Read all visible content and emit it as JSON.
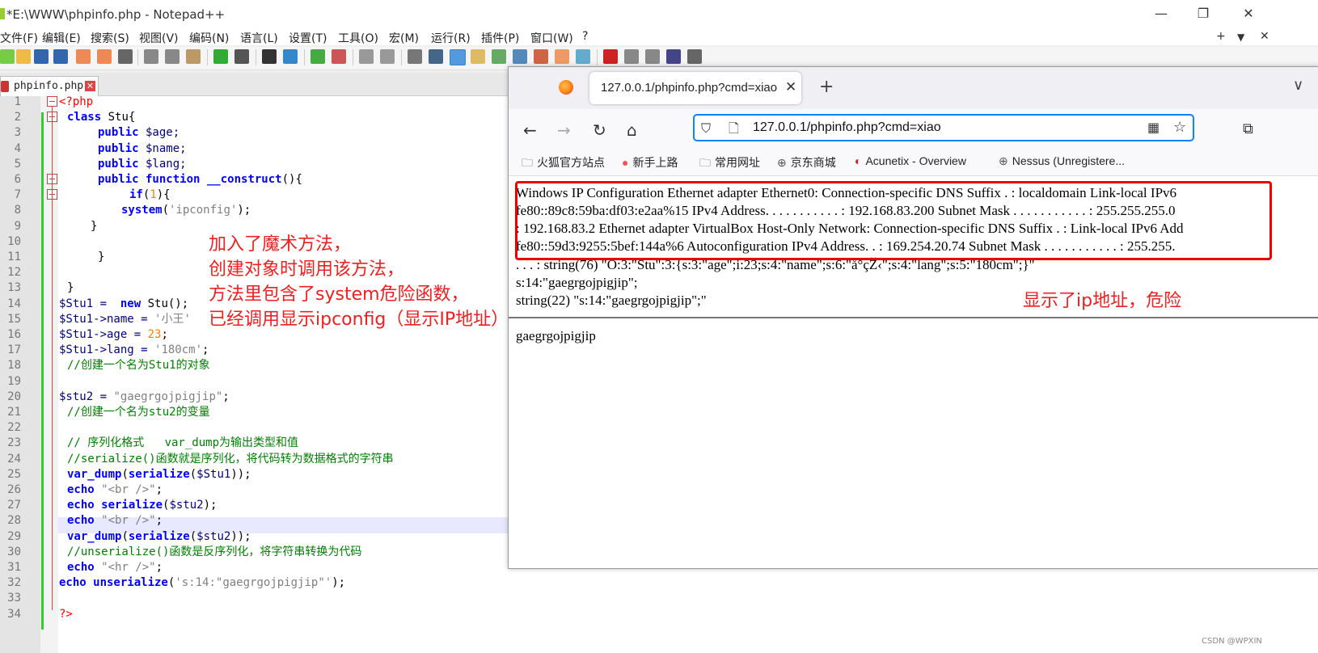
{
  "notepad": {
    "title": "*E:\\WWW\\phpinfo.php - Notepad++",
    "window_buttons": {
      "minimize": "—",
      "maximize": "❐",
      "close": "✕"
    },
    "menu": [
      "文件(F)",
      "编辑(E)",
      "搜索(S)",
      "视图(V)",
      "编码(N)",
      "语言(L)",
      "设置(T)",
      "工具(O)",
      "宏(M)",
      "运行(R)",
      "插件(P)",
      "窗口(W)",
      "?"
    ],
    "menu_right": {
      "plus": "+",
      "down": "▼",
      "close": "✕"
    },
    "tab_label": "phpinfo.php",
    "tab_close": "✕",
    "line_numbers": [
      "1",
      "2",
      "3",
      "4",
      "5",
      "6",
      "7",
      "8",
      "9",
      "10",
      "11",
      "12",
      "13",
      "14",
      "15",
      "16",
      "17",
      "18",
      "19",
      "20",
      "21",
      "22",
      "23",
      "24",
      "25",
      "26",
      "27",
      "28",
      "29",
      "30",
      "31",
      "32",
      "33",
      "34"
    ],
    "annotation": [
      "加入了魔术方法，",
      "创建对象时调用该方法，",
      "方法里包含了system危险函数，",
      "已经调用显示ipconfig（显示IP地址）"
    ]
  },
  "code": {
    "l1": "<?php",
    "l2_kw": "class",
    "l2_rest": " Stu{",
    "l3_kw": "public",
    "l3_var": " $age;",
    "l4_kw": "public",
    "l4_var": " $name;",
    "l5_kw": "public",
    "l5_var": " $lang;",
    "l6_kw": "public function",
    "l6_fn": " __construct",
    "l6_rest": "(){",
    "l7_kw": "if",
    "l7_p1": "(",
    "l7_n": "1",
    "l7_p2": "){",
    "l8_kw": "system",
    "l8_p1": "(",
    "l8_s": "'ipconfig'",
    "l8_p2": ");",
    "l9": "}",
    "l11": "}",
    "l13": "}",
    "l14_var": "$Stu1 = ",
    "l14_kw": " new",
    "l14_rest": " Stu();",
    "l15_var": "$Stu1->name = ",
    "l15_s": "'小王'",
    "l16_var": "$Stu1->age = ",
    "l16_n": "23",
    "l16_p": ";",
    "l17_var": "$Stu1->lang = ",
    "l17_s": "'180cm'",
    "l17_p": ";",
    "l18_c": "//创建一个名为Stu1的对象",
    "l20_var": "$stu2 = ",
    "l20_s": "\"gaegrgojpigjip\"",
    "l20_p": ";",
    "l21_c": "//创建一个名为stu2的变量",
    "l23_c": "// 序列化格式   var_dump为输出类型和值",
    "l24_c": "//serialize()函数就是序列化，将代码转为数据格式的字符串",
    "l25_kw1": "var_dump",
    "l25_p1": "(",
    "l25_kw2": "serialize",
    "l25_p2": "(",
    "l25_var": "$Stu1",
    "l25_p3": "));",
    "l26_kw": "echo",
    "l26_s": " \"<br />\"",
    "l26_p": ";",
    "l27_kw": "echo",
    "l27_kw2": " serialize",
    "l27_p1": "(",
    "l27_var": "$stu2",
    "l27_p2": ");",
    "l28_kw": "echo",
    "l28_s": " \"<br />\"",
    "l28_p": ";",
    "l29_kw1": "var_dump",
    "l29_p1": "(",
    "l29_kw2": "serialize",
    "l29_p2": "(",
    "l29_var": "$stu2",
    "l29_p3": "));",
    "l30_c": "//unserialize()函数是反序列化，将字符串转换为代码",
    "l31_kw": "echo",
    "l31_s": " \"<hr />\"",
    "l31_p": ";",
    "l32_kw": "echo",
    "l32_kw2": " unserialize",
    "l32_p1": "(",
    "l32_s": "'s:14:\"gaegrgojpigjip\"'",
    "l32_p2": ");",
    "l34": "?>"
  },
  "browser": {
    "tab_title": "127.0.0.1/phpinfo.php?cmd=xiao",
    "tab_close": "✕",
    "new_tab": "+",
    "tabs_menu": "∨",
    "nav": {
      "back": "←",
      "forward": "→",
      "reload": "↻",
      "home": "⌂"
    },
    "url": "127.0.0.1/phpinfo.php?cmd=xiao",
    "extensions_icon": "⧉",
    "bookmarks": [
      {
        "icon": "folder-icon",
        "label": "火狐官方站点"
      },
      {
        "icon": "firefox-icon",
        "label": "新手上路"
      },
      {
        "icon": "folder-icon",
        "label": "常用网址"
      },
      {
        "icon": "globe-icon",
        "label": "京东商城"
      },
      {
        "icon": "acunetix-icon",
        "label": "Acunetix - Overview"
      },
      {
        "icon": "globe-icon",
        "label": "Nessus (Unregistere..."
      }
    ],
    "content_lines": [
      "Windows IP Configuration Ethernet adapter Ethernet0: Connection-specific DNS Suffix . : localdomain Link-local IPv6",
      "fe80::89c8:59ba:df03:e2aa%15 IPv4 Address. . . . . . . . . . . : 192.168.83.200 Subnet Mask . . . . . . . . . . . : 255.255.255.0",
      ": 192.168.83.2 Ethernet adapter VirtualBox Host-Only Network: Connection-specific DNS Suffix . : Link-local IPv6 Add",
      "fe80::59d3:9255:5bef:144a%6 Autoconfiguration IPv4 Address. . : 169.254.20.74 Subnet Mask . . . . . . . . . . . : 255.255.",
      ". . . : string(76) \"O:3:\"Stu\":3:{s:3:\"age\";i:23;s:4:\"name\";s:6:\"å°çŽ‹\";s:4:\"lang\";s:5:\"180cm\";}\"",
      "s:14:\"gaegrgojpigjip\";",
      "string(22) \"s:14:\"gaegrgojpigjip\";\""
    ],
    "after_hr": "gaegrgojpigjip",
    "annotation": "显示了ip地址，危险"
  },
  "watermark": "CSDN @WPXIN"
}
